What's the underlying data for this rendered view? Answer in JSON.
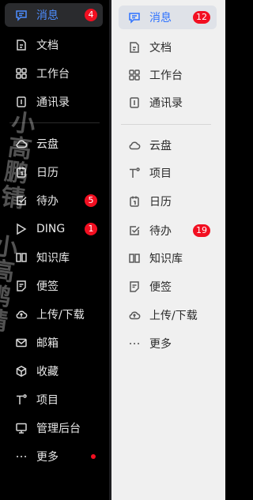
{
  "dark_sidebar": {
    "items": [
      {
        "label": "消息",
        "badge": "4"
      },
      {
        "label": "文档"
      },
      {
        "label": "工作台"
      },
      {
        "label": "通讯录"
      },
      {
        "label": "云盘"
      },
      {
        "label": "日历"
      },
      {
        "label": "待办",
        "badge": "5"
      },
      {
        "label": "DING",
        "badge": "1"
      },
      {
        "label": "知识库"
      },
      {
        "label": "便签"
      },
      {
        "label": "上传/下载"
      },
      {
        "label": "邮箱"
      },
      {
        "label": "收藏"
      },
      {
        "label": "项目"
      },
      {
        "label": "管理后台"
      },
      {
        "label": "更多"
      }
    ]
  },
  "light_sidebar": {
    "items": [
      {
        "label": "消息",
        "badge": "12"
      },
      {
        "label": "文档"
      },
      {
        "label": "工作台"
      },
      {
        "label": "通讯录"
      },
      {
        "label": "云盘"
      },
      {
        "label": "项目"
      },
      {
        "label": "日历"
      },
      {
        "label": "待办",
        "badge": "19"
      },
      {
        "label": "知识库"
      },
      {
        "label": "便签"
      },
      {
        "label": "上传/下载"
      },
      {
        "label": "更多"
      }
    ]
  },
  "colors": {
    "accent_dark": "#4d8dff",
    "accent_light": "#2f73ff",
    "badge": "#f20f21"
  }
}
